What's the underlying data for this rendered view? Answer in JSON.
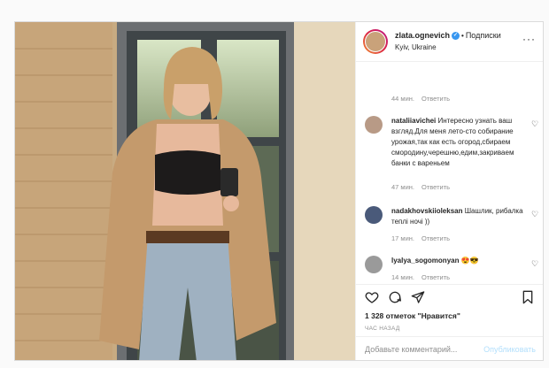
{
  "post": {
    "username": "zlata.ognevich",
    "follow_label": "Подписки",
    "location": "Kyiv, Ukraine",
    "likes": "1 328 отметок \"Нравится\"",
    "time": "ЧАС НАЗАД",
    "add_comment_placeholder": "Добавьте комментарий...",
    "publish_label": "Опубликовать"
  },
  "comments": [
    {
      "meta_time": "44 мин.",
      "reply": "Ответить"
    },
    {
      "username": "nataliiavichei",
      "text": "Интересно узнать ваш взгляд.Для меня лето-сто собирание урожая,так как есть огород,сбираем смородину,черешню,едим,закриваем банки с вареньем",
      "meta_time": "47 мин.",
      "reply": "Ответить"
    },
    {
      "username": "nadakhovskiioleksan",
      "text": "Шашлик, рибалка теплі ночі ))",
      "meta_time": "17 мин.",
      "reply": "Ответить"
    },
    {
      "username": "lyalya_sogomonyan",
      "text": "😍😎",
      "meta_time": "14 мин.",
      "reply": "Ответить"
    }
  ],
  "icons": {
    "heart": "heart-icon",
    "comment": "comment-icon",
    "share": "share-icon",
    "bookmark": "bookmark-icon",
    "more": "more-icon",
    "verified": "verified-icon"
  },
  "colors": {
    "link": "#3897f0",
    "muted": "#8e8e8e",
    "publish": "#b2dffc"
  }
}
